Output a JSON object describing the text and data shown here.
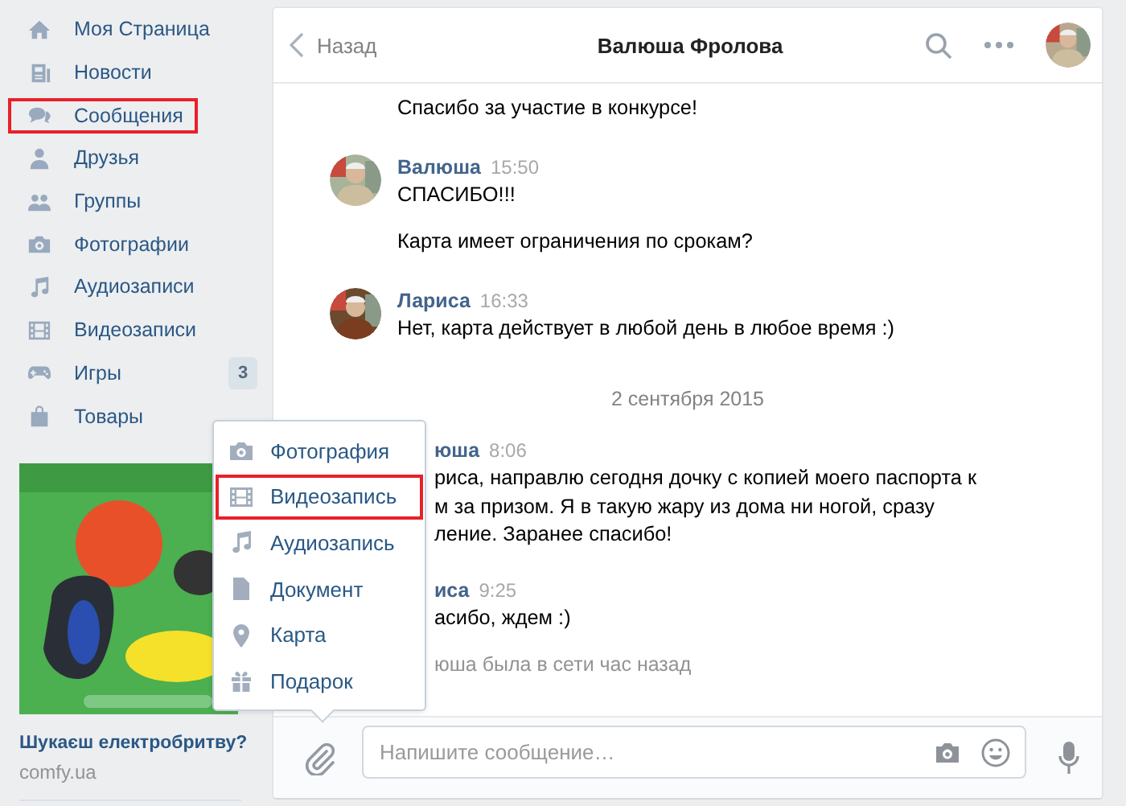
{
  "sidebar": {
    "items": [
      {
        "label": "Моя Страница",
        "highlighted": false
      },
      {
        "label": "Новости",
        "highlighted": false
      },
      {
        "label": "Сообщения",
        "highlighted": true
      },
      {
        "label": "Друзья",
        "highlighted": false
      },
      {
        "label": "Группы",
        "highlighted": false
      },
      {
        "label": "Фотографии",
        "highlighted": false
      },
      {
        "label": "Аудиозаписи",
        "highlighted": false
      },
      {
        "label": "Видеозаписи",
        "highlighted": false
      },
      {
        "label": "Игры",
        "highlighted": false,
        "badge": "3"
      },
      {
        "label": "Товары",
        "highlighted": false
      }
    ]
  },
  "ad": {
    "kind": "picture",
    "title": "Шукаєш електробритву?",
    "domain": "comfy.ua"
  },
  "chat": {
    "back": "Назад",
    "title": "Валюша Фролова",
    "messages": [
      {
        "kind": "continuation",
        "texts": [
          {
            "lines": [
              "Спасибо за участие в конкурсе!"
            ]
          }
        ]
      },
      {
        "kind": "message",
        "author": "Валюша",
        "time": "15:50",
        "texts": [
          {
            "lines": [
              "СПАСИБО!!!"
            ]
          },
          {
            "lines": [
              "Карта имеет ограничения по срокам?"
            ]
          }
        ]
      },
      {
        "kind": "message",
        "author": "Лариса",
        "time": "16:33",
        "texts": [
          {
            "lines": [
              "Нет, карта действует в любой день в любое время :)"
            ]
          }
        ]
      },
      {
        "kind": "date",
        "text": "2 сентября 2015"
      },
      {
        "kind": "covered",
        "author": "юша",
        "time": "8:06",
        "texts": [
          {
            "lines": [
              "риса, направлю сегодня дочку с копией моего паспорта к",
              "м за призом. Я в такую жару из дома ни ногой, сразу",
              "ление. Заранее спасибо!"
            ]
          }
        ]
      },
      {
        "kind": "covered",
        "author": "иса",
        "time": "9:25",
        "texts": [
          {
            "lines": [
              "асибо, ждем :)"
            ]
          }
        ]
      },
      {
        "kind": "status",
        "text": "юша была в сети час назад"
      }
    ],
    "input": {
      "placeholder": "Напишите сообщение…"
    }
  },
  "attach_menu": {
    "items": [
      {
        "label": "Фотография",
        "highlighted": false
      },
      {
        "label": "Видеозапись",
        "highlighted": true
      },
      {
        "label": "Аудиозапись",
        "highlighted": false
      },
      {
        "label": "Документ",
        "highlighted": false
      },
      {
        "label": "Карта",
        "highlighted": false
      },
      {
        "label": "Подарок",
        "highlighted": false
      }
    ]
  }
}
